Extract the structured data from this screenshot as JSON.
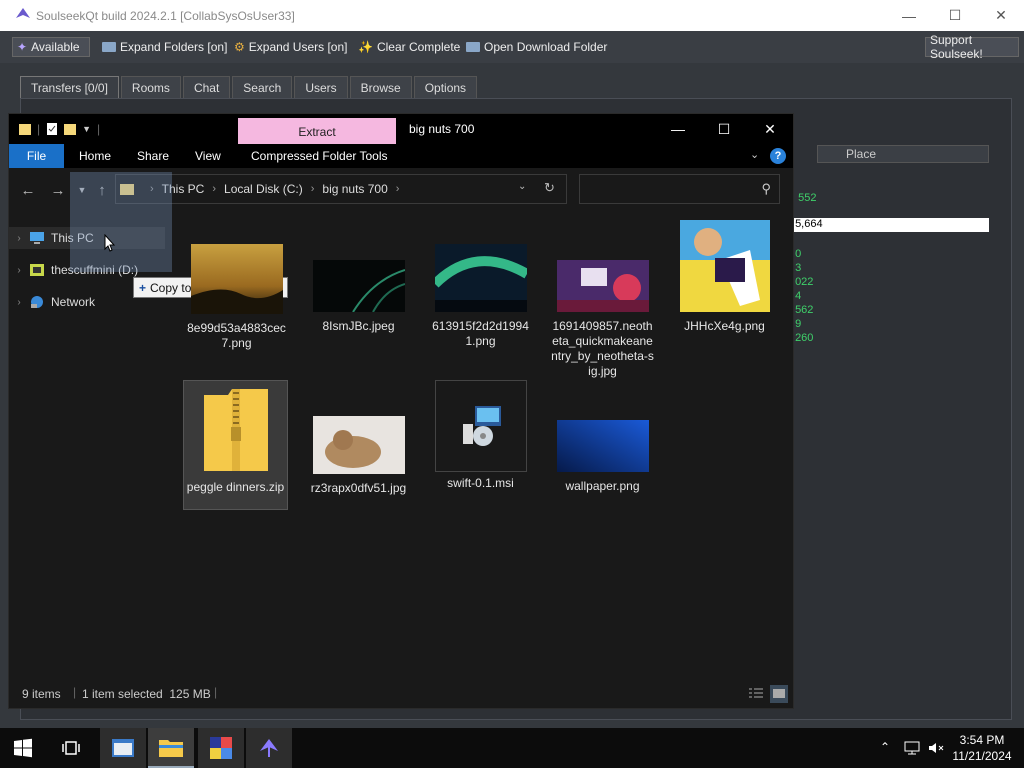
{
  "soulseek": {
    "title": "SoulseekQt build 2024.2.1 [CollabSysOsUser33]",
    "toolbar": {
      "status_label": "Available",
      "expand_folders": "Expand Folders [on]",
      "expand_users": "Expand Users [on]",
      "clear_complete": "Clear Complete",
      "open_download_folder": "Open Download Folder",
      "support": "Support Soulseek!"
    },
    "tabs": [
      "Transfers [0/0]",
      "Rooms",
      "Chat",
      "Search",
      "Users",
      "Browse",
      "Options"
    ],
    "active_tab": "Transfers [0/0]",
    "place_header": "Place",
    "place_values": [
      "552",
      "5,664",
      "0",
      "3",
      "022",
      "4",
      "562",
      "9",
      "260"
    ]
  },
  "explorer": {
    "title": "big nuts 700",
    "extract_label": "Extract",
    "ribbon_tabs": [
      "File",
      "Home",
      "Share",
      "View",
      "Compressed Folder Tools"
    ],
    "breadcrumb": [
      "This PC",
      "Local Disk (C:)",
      "big nuts 700"
    ],
    "search_placeholder": "",
    "nav_items": [
      "This PC",
      "thescuffmini (D:)",
      "Network"
    ],
    "drag_tooltip": "Copy to thescuffmini (D:)",
    "files": [
      {
        "name": "8e99d53a4883cec7.png",
        "icon": "sunset-image-icon"
      },
      {
        "name": "8IsmJBc.jpeg",
        "icon": "dark-abstract-image-icon"
      },
      {
        "name": "613915f2d2d19941.png",
        "icon": "aurora-image-icon"
      },
      {
        "name": "1691409857.neotheta_quickmakeanentry_by_neotheta-sig.jpg",
        "icon": "art-image-icon"
      },
      {
        "name": "JHHcXe4g.png",
        "icon": "anime-image-icon"
      },
      {
        "name": "peggle dinners.zip",
        "icon": "zip-folder-icon"
      },
      {
        "name": "rz3rapx0dfv51.jpg",
        "icon": "kitten-image-icon"
      },
      {
        "name": "swift-0.1.msi",
        "icon": "installer-icon"
      },
      {
        "name": "wallpaper.png",
        "icon": "blue-wallpaper-image-icon"
      }
    ],
    "status": {
      "count": "9 items",
      "selection": "1 item selected  125 MB"
    }
  },
  "taskbar": {
    "time": "3:54 PM",
    "date": "11/21/2024"
  },
  "colors": {
    "extract_tab": "#f5b8e0",
    "file_tab": "#1a70c8",
    "place_values": "#3fd06a"
  }
}
